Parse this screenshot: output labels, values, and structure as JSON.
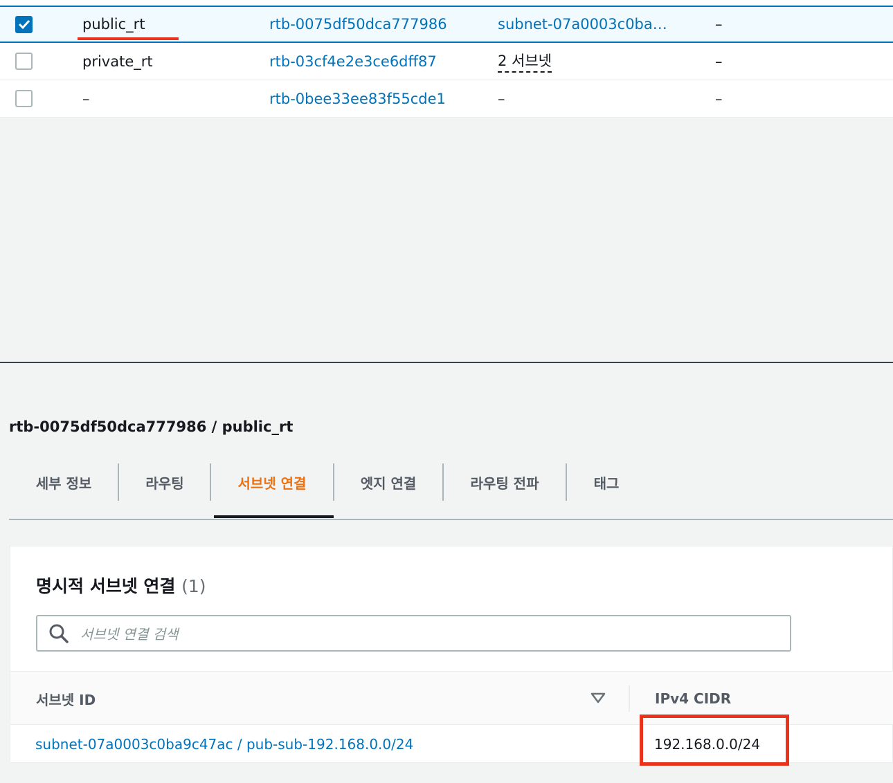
{
  "route_tables": [
    {
      "name": "public_rt",
      "id": "rtb-0075df50dca777986",
      "subnet": "subnet-07a0003c0ba…",
      "edge": "–",
      "selected": true
    },
    {
      "name": "private_rt",
      "id": "rtb-03cf4e2e3ce6dff87",
      "subnet": "2 서브넷",
      "edge": "–",
      "selected": false
    },
    {
      "name": "–",
      "id": "rtb-0bee33ee83f55cde1",
      "subnet": "–",
      "edge": "–",
      "selected": false
    }
  ],
  "detail": {
    "title": "rtb-0075df50dca777986 / public_rt",
    "tabs": [
      "세부 정보",
      "라우팅",
      "서브넷 연결",
      "엣지 연결",
      "라우팅 전파",
      "태그"
    ],
    "active_tab": "서브넷 연결"
  },
  "subnet_assoc": {
    "title": "명시적 서브넷 연결",
    "count": "(1)",
    "search_placeholder": "서브넷 연결 검색",
    "columns": [
      "서브넷 ID",
      "IPv4 CIDR"
    ],
    "rows": [
      {
        "subnet": "subnet-07a0003c0ba9c47ac / pub-sub-192.168.0.0/24",
        "cidr": "192.168.0.0/24"
      }
    ]
  },
  "colors": {
    "link": "#0073bb",
    "active_tab": "#ec7211",
    "highlight": "#e8341c",
    "selected_row": "#f1faff"
  }
}
